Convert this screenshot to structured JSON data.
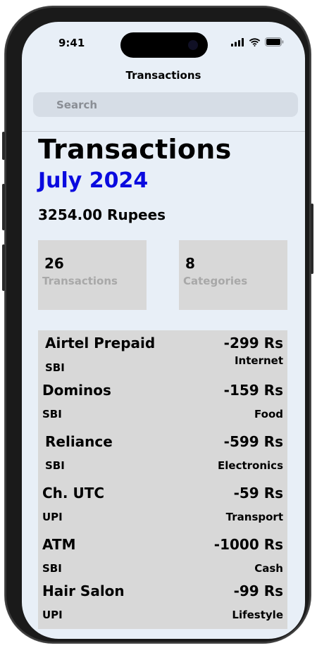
{
  "status_bar": {
    "time": "9:41"
  },
  "nav": {
    "title": "Transactions"
  },
  "search": {
    "placeholder": "Search"
  },
  "header": {
    "title": "Transactions",
    "month": "July 2024",
    "total": "3254.00 Rupees",
    "month_color": "#0a0adf"
  },
  "stats": [
    {
      "value": "26",
      "label": "Transactions"
    },
    {
      "value": "8",
      "label": "Categories"
    }
  ],
  "transactions": [
    {
      "merchant": "Airtel Prepaid",
      "amount": "-299 Rs",
      "source": "SBI",
      "category": "Internet"
    },
    {
      "merchant": "Dominos",
      "amount": "-159 Rs",
      "source": "SBI",
      "category": "Food"
    },
    {
      "merchant": "Reliance",
      "amount": "-599 Rs",
      "source": "SBI",
      "category": "Electronics"
    },
    {
      "merchant": "Ch. UTC",
      "amount": "-59 Rs",
      "source": "UPI",
      "category": "Transport"
    },
    {
      "merchant": "ATM",
      "amount": "-1000 Rs",
      "source": "SBI",
      "category": "Cash"
    },
    {
      "merchant": "Hair Salon",
      "amount": "-99 Rs",
      "source": "UPI",
      "category": "Lifestyle"
    }
  ],
  "icons": {
    "signal": "cellular-signal-icon",
    "wifi": "wifi-icon",
    "battery": "battery-icon",
    "search": "search-icon"
  },
  "colors": {
    "screen_background": "#e8eff7",
    "card_background": "#d8d8d8",
    "muted_label": "#a8a8a8"
  }
}
